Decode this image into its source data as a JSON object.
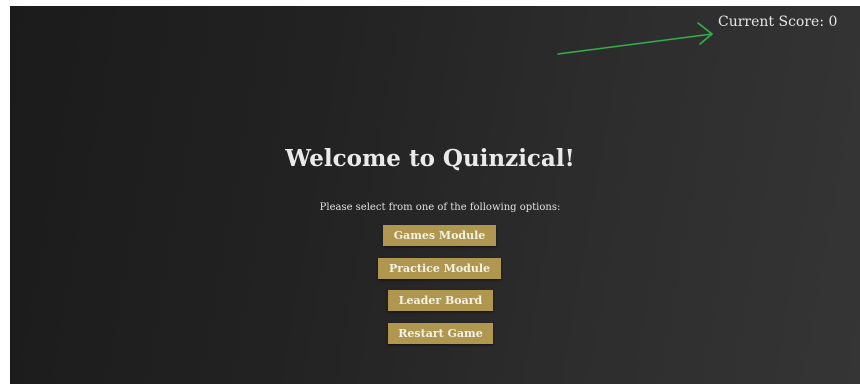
{
  "header": {
    "score_label": "Current Score: 0"
  },
  "menu": {
    "title": "Welcome to Quinzical!",
    "instruction": "Please select from one of the following options:",
    "buttons": [
      {
        "label": "Games Module"
      },
      {
        "label": "Practice Module"
      },
      {
        "label": "Leader Board"
      },
      {
        "label": "Restart Game"
      }
    ]
  },
  "colors": {
    "background": "#222222",
    "button": "#b0974f",
    "annotation_arrow": "#2fb24a"
  },
  "icons": {
    "annotation": "arrow-right-icon"
  }
}
